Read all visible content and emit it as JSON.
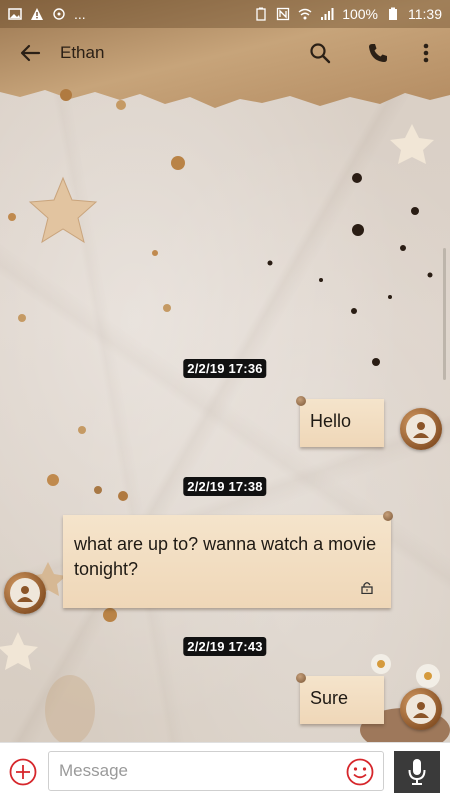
{
  "status_bar": {
    "battery": "100%",
    "time": "11:39",
    "more": "..."
  },
  "toolbar": {
    "contact_name": "Ethan"
  },
  "messages": [
    {
      "timestamp": "2/2/19 17:36",
      "text": "Hello",
      "direction": "outgoing"
    },
    {
      "timestamp": "2/2/19 17:38",
      "text": "what are up to? wanna watch a movie tonight?",
      "direction": "incoming",
      "locked": true
    },
    {
      "timestamp": "2/2/19 17:43",
      "text": "Sure",
      "direction": "outgoing"
    }
  ],
  "composer": {
    "placeholder": "Message"
  },
  "colors": {
    "attach_red": "#d6262b",
    "emoji_red": "#d6262b",
    "note": "#f2dec2",
    "timestamp_bg": "#111111"
  },
  "icons": [
    "back-arrow-icon",
    "search-icon",
    "phone-icon",
    "more-vertical-icon",
    "add-circle-icon",
    "emoji-icon",
    "microphone-icon",
    "lock-icon",
    "avatar-person-icon"
  ]
}
